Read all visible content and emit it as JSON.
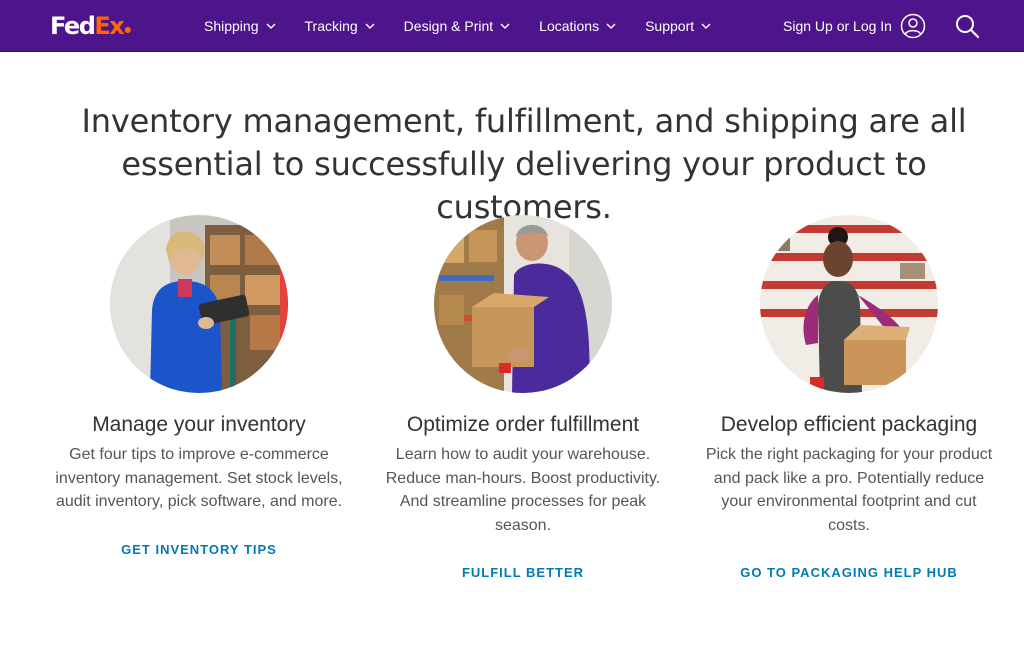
{
  "header": {
    "logo": {
      "fed": "Fed",
      "ex": "Ex"
    },
    "nav": [
      {
        "label": "Shipping",
        "icon": "chevron-down-icon"
      },
      {
        "label": "Tracking",
        "icon": "chevron-down-icon"
      },
      {
        "label": "Design & Print",
        "icon": "chevron-down-icon"
      },
      {
        "label": "Locations",
        "icon": "chevron-down-icon"
      },
      {
        "label": "Support",
        "icon": "chevron-down-icon"
      }
    ],
    "signin_label": "Sign Up or Log In",
    "signin_icon": "user-icon",
    "search_icon": "search-icon",
    "colors": {
      "bar": "#4d148c",
      "brand_orange": "#ff6600"
    }
  },
  "main": {
    "headline": [
      "Inventory management, fulfillment, and shipping are all",
      "essential to successfully delivering your product to customers."
    ],
    "cards": [
      {
        "title": "Manage your inventory",
        "description": "Get four tips to improve e-commerce inventory management. Set stock levels, audit inventory, pick software, and more.",
        "link": "GET INVENTORY TIPS",
        "image": "woman-with-tablet-in-warehouse"
      },
      {
        "title": "Optimize order fulfillment",
        "description": "Learn how to audit your warehouse. Reduce man-hours. Boost productivity. And streamline processes for peak season.",
        "link": "FULFILL BETTER",
        "image": "man-packing-box-in-warehouse"
      },
      {
        "title": "Develop efficient packaging",
        "description": "Pick the right packaging for your product and pack like a pro. Potentially reduce your environmental footprint and cut costs.",
        "link": "GO TO PACKAGING HELP HUB",
        "image": "woman-packing-box"
      }
    ],
    "link_color": "#007ab7"
  }
}
